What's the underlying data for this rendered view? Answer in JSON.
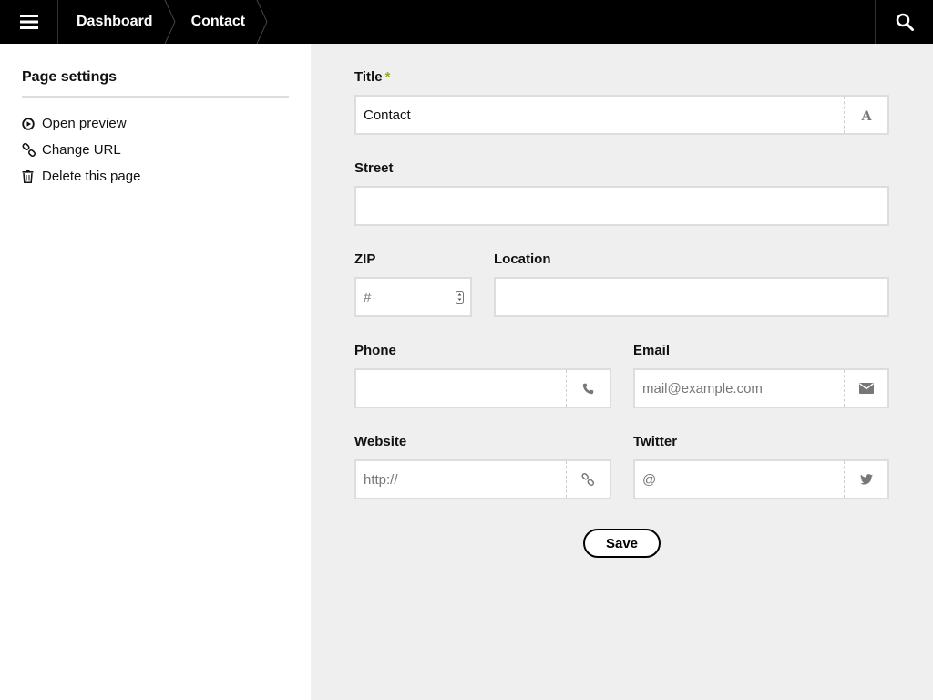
{
  "topbar": {
    "menu_icon": "hamburger-icon",
    "breadcrumbs": [
      "Dashboard",
      "Contact"
    ],
    "search_icon": "search-icon"
  },
  "sidebar": {
    "title": "Page settings",
    "items": [
      {
        "label": "Open preview",
        "icon": "play-circle-icon"
      },
      {
        "label": "Change URL",
        "icon": "chain-link-icon"
      },
      {
        "label": "Delete this page",
        "icon": "trash-icon"
      }
    ]
  },
  "form": {
    "title": {
      "label": "Title",
      "required_mark": "*",
      "value": "Contact",
      "icon": "font-icon"
    },
    "street": {
      "label": "Street",
      "value": ""
    },
    "zip": {
      "label": "ZIP",
      "placeholder": "#"
    },
    "location": {
      "label": "Location",
      "value": ""
    },
    "phone": {
      "label": "Phone",
      "value": "",
      "icon": "phone-icon"
    },
    "email": {
      "label": "Email",
      "placeholder": "mail@example.com",
      "icon": "envelope-icon"
    },
    "website": {
      "label": "Website",
      "placeholder": "http://",
      "icon": "chain-link-icon"
    },
    "twitter": {
      "label": "Twitter",
      "placeholder": "@",
      "icon": "twitter-icon"
    },
    "save_label": "Save"
  },
  "colors": {
    "topbar_bg": "#000000",
    "main_bg": "#efefef",
    "required_accent": "#8dae28",
    "input_border": "#dddddd"
  }
}
